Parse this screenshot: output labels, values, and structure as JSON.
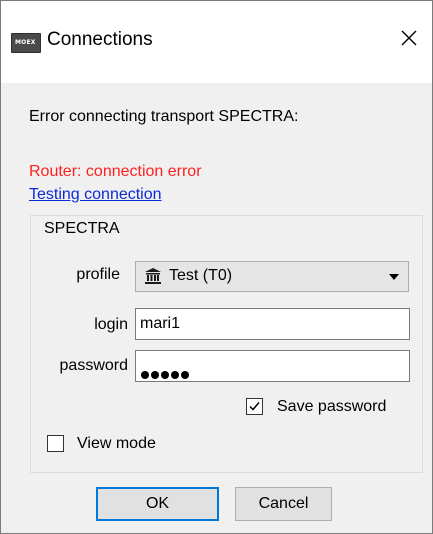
{
  "window": {
    "title": "Connections",
    "icon_label": "MOEX",
    "icon": "app-logo-icon",
    "close_icon": "close-icon"
  },
  "messages": {
    "error_text": "Error connecting transport SPECTRA:",
    "router_error": "Router: connection error",
    "testing_link": "Testing connection"
  },
  "group": {
    "title": "SPECTRA",
    "profile": {
      "label": "profile",
      "value": "Test (T0)",
      "icon": "bank-building-icon"
    },
    "login": {
      "label": "login",
      "value": "mari1"
    },
    "password": {
      "label": "password",
      "masked_length": 5
    },
    "save_password": {
      "label": "Save password",
      "checked": true
    },
    "view_mode": {
      "label": "View mode",
      "checked": false
    }
  },
  "buttons": {
    "ok": "OK",
    "cancel": "Cancel"
  },
  "colors": {
    "error": "#ff2020",
    "link": "#0b2bd8",
    "focus_border": "#0078d7",
    "dialog_bg": "#f0f0f0"
  }
}
